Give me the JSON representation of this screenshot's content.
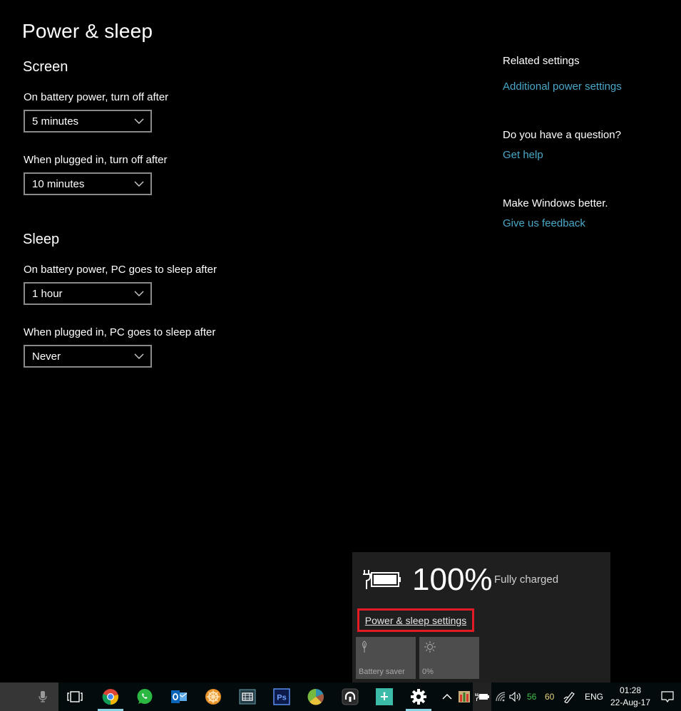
{
  "page": {
    "title": "Power & sleep",
    "screen": {
      "heading": "Screen",
      "battery_label": "On battery power, turn off after",
      "battery_value": "5 minutes",
      "plugged_label": "When plugged in, turn off after",
      "plugged_value": "10 minutes"
    },
    "sleep": {
      "heading": "Sleep",
      "battery_label": "On battery power, PC goes to sleep after",
      "battery_value": "1 hour",
      "plugged_label": "When plugged in, PC goes to sleep after",
      "plugged_value": "Never"
    }
  },
  "sidebar": {
    "related_heading": "Related settings",
    "related_link": "Additional power settings",
    "question_heading": "Do you have a question?",
    "question_link": "Get help",
    "feedback_heading": "Make Windows better.",
    "feedback_link": "Give us feedback"
  },
  "battery_flyout": {
    "percent": "100%",
    "status": "Fully charged",
    "settings_link": "Power & sleep settings",
    "tiles": [
      {
        "label": "Battery saver",
        "icon": "leaf-icon"
      },
      {
        "label": "0%",
        "icon": "brightness-icon"
      }
    ]
  },
  "taskbar": {
    "apps": [
      "task-view",
      "chrome",
      "whatsapp",
      "outlook",
      "app-orange",
      "video-editor",
      "photoshop",
      "reaper",
      "headphones-app",
      "app-teal",
      "settings"
    ],
    "ps_label": "Ps",
    "tray": {
      "temp1": "56",
      "temp2": "60",
      "language": "ENG",
      "time": "01:28",
      "date": "22-Aug-17"
    },
    "colors": {
      "temp1": "#3fbf4a",
      "temp2": "#e8d27a"
    }
  }
}
